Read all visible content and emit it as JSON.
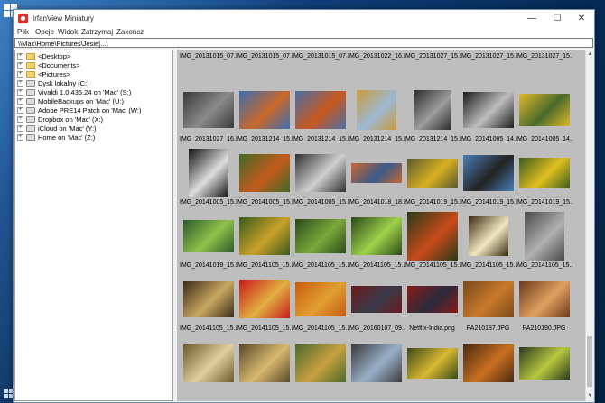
{
  "window": {
    "title": "IrfanView Miniatury",
    "controls": {
      "minimize": "—",
      "maximize": "☐",
      "close": "✕"
    }
  },
  "menu": [
    "Plik",
    "Opcje",
    "Widok",
    "Zatrzymaj",
    "Zakończ"
  ],
  "path": "\\\\Mac\\Home\\Pictures\\Jesie[...\\",
  "tree": [
    {
      "label": "<Desktop>",
      "icon": "folder"
    },
    {
      "label": "<Documents>",
      "icon": "folder"
    },
    {
      "label": "<Pictures>",
      "icon": "folder"
    },
    {
      "label": "Dysk lokalny (C:)",
      "icon": "drive"
    },
    {
      "label": "Vivaldi 1.0.435.24 on 'Mac' (S:)",
      "icon": "drive"
    },
    {
      "label": "MobileBackups on 'Mac' (U:)",
      "icon": "drive"
    },
    {
      "label": "Adobe PRE14 Patch on 'Mac' (W:)",
      "icon": "drive"
    },
    {
      "label": "Dropbox on 'Mac' (X:)",
      "icon": "drive"
    },
    {
      "label": "iCloud on 'Mac' (Y:)",
      "icon": "drive"
    },
    {
      "label": "Home on 'Mac' (Z:)",
      "icon": "drive"
    }
  ],
  "thumbnails": {
    "top_labels": [
      "IMG_20131015_07...",
      "IMG_20131015_07...",
      "IMG_20131015_07...",
      "IMG_20131022_16...",
      "IMG_20131027_15...",
      "IMG_20131027_15...",
      "IMG_20131027_15..."
    ],
    "rows": [
      [
        {
          "name": "IMG_20131027_16...",
          "c1": "#3a3a3a",
          "c2": "#8a8a8a",
          "w": 56,
          "h": 40
        },
        {
          "name": "IMG_20131214_15...",
          "c1": "#3b6fb0",
          "c2": "#c9672a",
          "w": 56,
          "h": 42
        },
        {
          "name": "IMG_20131214_15...",
          "c1": "#4a6fa8",
          "c2": "#c8581f",
          "w": 56,
          "h": 42
        },
        {
          "name": "IMG_20131214_15...",
          "c1": "#c99a3a",
          "c2": "#9db8d4",
          "w": 44,
          "h": 44
        },
        {
          "name": "IMG_20131214_15...",
          "c1": "#2a2a2a",
          "c2": "#9c9c9c",
          "w": 42,
          "h": 44
        },
        {
          "name": "IMG_20141005_14...",
          "c1": "#1a1a1a",
          "c2": "#bdbdbd",
          "w": 56,
          "h": 40
        },
        {
          "name": "IMG_20141005_14...",
          "c1": "#e0b92a",
          "c2": "#4a6a2a",
          "w": 56,
          "h": 36
        }
      ],
      [
        {
          "name": "IMG_20141005_15...",
          "c1": "#111111",
          "c2": "#dddddd",
          "w": 44,
          "h": 54
        },
        {
          "name": "IMG_20141005_15...",
          "c1": "#3f6a25",
          "c2": "#c45a1e",
          "w": 56,
          "h": 42
        },
        {
          "name": "IMG_20141005_15...",
          "c1": "#2f2f2f",
          "c2": "#cfcfcf",
          "w": 56,
          "h": 42
        },
        {
          "name": "IMG_20141018_18...",
          "c1": "#c9662b",
          "c2": "#3a5a8a",
          "w": 56,
          "h": 22
        },
        {
          "name": "IMG_20141019_15...",
          "c1": "#5a5a30",
          "c2": "#d8b020",
          "w": 56,
          "h": 32
        },
        {
          "name": "IMG_20141019_15...",
          "c1": "#4a7fb8",
          "c2": "#222222",
          "w": 56,
          "h": 40
        },
        {
          "name": "IMG_20141019_15...",
          "c1": "#3a5a20",
          "c2": "#e0c020",
          "w": 56,
          "h": 34
        }
      ],
      [
        {
          "name": "IMG_20141019_15...",
          "c1": "#2a5a2a",
          "c2": "#8fc24a",
          "w": 56,
          "h": 36
        },
        {
          "name": "IMG_20141105_15...",
          "c1": "#3a5a1a",
          "c2": "#c8a02a",
          "w": 56,
          "h": 42
        },
        {
          "name": "IMG_20141105_15...",
          "c1": "#2a4a1a",
          "c2": "#7aa83a",
          "w": 56,
          "h": 38
        },
        {
          "name": "IMG_20141105_15...",
          "c1": "#2a4a1a",
          "c2": "#9fd04a",
          "w": 56,
          "h": 42
        },
        {
          "name": "IMG_20141105_15...",
          "c1": "#2a3a1a",
          "c2": "#c84a1a",
          "w": 56,
          "h": 54
        },
        {
          "name": "IMG_20141105_15...",
          "c1": "#3a2a10",
          "c2": "#f0e8c0",
          "w": 44,
          "h": 44
        },
        {
          "name": "IMG_20141105_15...",
          "c1": "#4a4a4a",
          "c2": "#b0b0b0",
          "w": 44,
          "h": 54
        }
      ],
      [
        {
          "name": "IMG_20141105_15...",
          "c1": "#3a2a1a",
          "c2": "#c8a860",
          "w": 56,
          "h": 40
        },
        {
          "name": "IMG_20141105_15...",
          "c1": "#c81a1a",
          "c2": "#e0b040",
          "w": 56,
          "h": 42
        },
        {
          "name": "IMG_20141105_15...",
          "c1": "#c85a10",
          "c2": "#e0a030",
          "w": 56,
          "h": 38
        },
        {
          "name": "IMG_20160107_09...",
          "c1": "#6a1a1a",
          "c2": "#3a3a4a",
          "w": 56,
          "h": 30
        },
        {
          "name": "Netflix-India.png",
          "c1": "#8a1a1a",
          "c2": "#2a2a3a",
          "w": 56,
          "h": 30
        },
        {
          "name": "PA210187.JPG",
          "c1": "#7a4a1a",
          "c2": "#c8782a",
          "w": 56,
          "h": 40
        },
        {
          "name": "PA210190.JPG",
          "c1": "#6a3a1a",
          "c2": "#e0a060",
          "w": 56,
          "h": 40
        }
      ],
      [
        {
          "name": "",
          "c1": "#6a5a2a",
          "c2": "#e0d0a0",
          "w": 56,
          "h": 42
        },
        {
          "name": "",
          "c1": "#5a4a2a",
          "c2": "#d8b870",
          "w": 56,
          "h": 42
        },
        {
          "name": "",
          "c1": "#4a6a2a",
          "c2": "#c8a040",
          "w": 56,
          "h": 42
        },
        {
          "name": "",
          "c1": "#3a3a3a",
          "c2": "#9ab0c8",
          "w": 56,
          "h": 42
        },
        {
          "name": "",
          "c1": "#3a4a1a",
          "c2": "#d8b830",
          "w": 56,
          "h": 34
        },
        {
          "name": "",
          "c1": "#4a2a10",
          "c2": "#c87020",
          "w": 56,
          "h": 42
        },
        {
          "name": "",
          "c1": "#2a3a1a",
          "c2": "#b8c840",
          "w": 56,
          "h": 36
        }
      ]
    ]
  }
}
